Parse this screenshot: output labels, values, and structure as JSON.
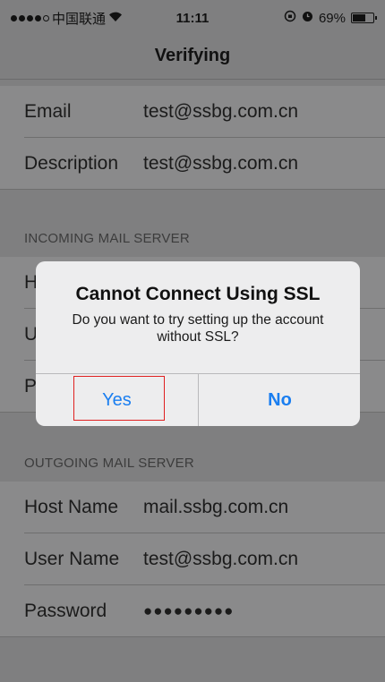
{
  "status_bar": {
    "carrier": "中国联通",
    "time": "11:11",
    "battery": "69%",
    "battery_level": 0.69
  },
  "nav": {
    "title": "Verifying"
  },
  "account": {
    "email_label": "Email",
    "email_value": "test@ssbg.com.cn",
    "description_label": "Description",
    "description_value": "test@ssbg.com.cn"
  },
  "incoming": {
    "header": "INCOMING MAIL SERVER",
    "row1_label": "H",
    "row2_label": "U",
    "row3_label": "P"
  },
  "outgoing": {
    "header": "OUTGOING MAIL SERVER",
    "host_label": "Host Name",
    "host_value": "mail.ssbg.com.cn",
    "user_label": "User Name",
    "user_value": "test@ssbg.com.cn",
    "password_label": "Password",
    "password_value": "●●●●●●●●●"
  },
  "dialog": {
    "title": "Cannot Connect Using SSL",
    "message": "Do you want to try setting up the account without SSL?",
    "yes_label": "Yes",
    "no_label": "No"
  }
}
